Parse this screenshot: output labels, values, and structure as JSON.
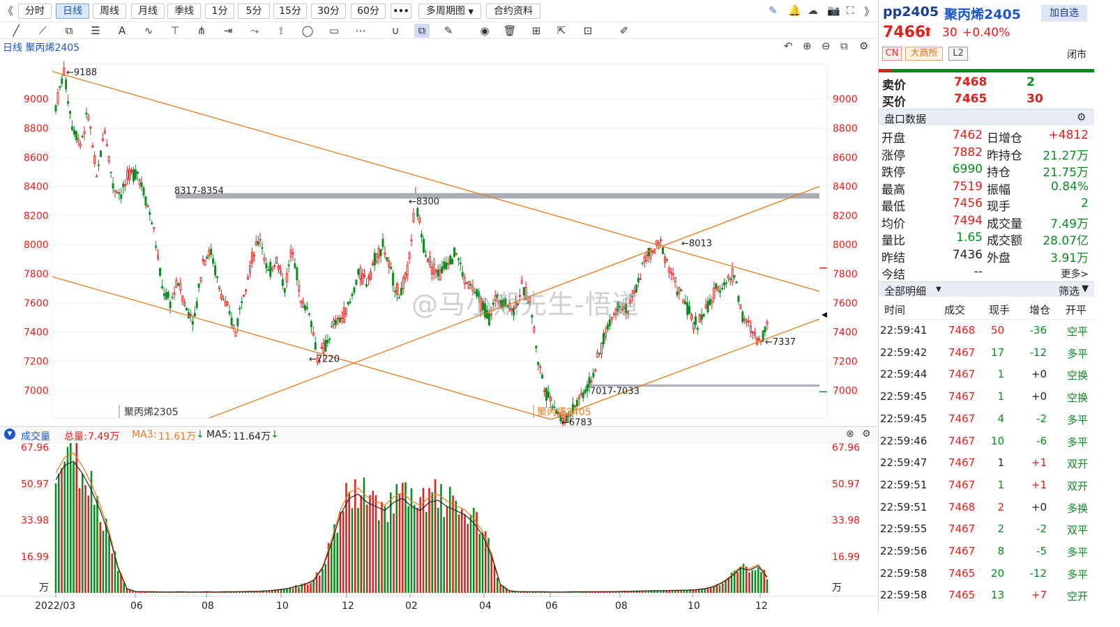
{
  "toolbar": {
    "back": "《",
    "periods": [
      {
        "label": "分时",
        "active": false
      },
      {
        "label": "日线",
        "active": true
      },
      {
        "label": "周线",
        "active": false
      },
      {
        "label": "月线",
        "active": false
      },
      {
        "label": "季线",
        "active": false
      },
      {
        "label": "1分",
        "active": false
      },
      {
        "label": "5分",
        "active": false
      },
      {
        "label": "15分",
        "active": false
      },
      {
        "label": "30分",
        "active": false
      },
      {
        "label": "60分",
        "active": false
      }
    ],
    "more": "•••",
    "multi": "多周期图",
    "contract": "合约资料",
    "right_icons": [
      "pen-icon",
      "bell-icon",
      "cloud-icon",
      "camera-icon",
      "fullscreen-icon",
      "collapse-icon"
    ],
    "right_glyphs": [
      "✎",
      "🔔",
      "☁",
      "📷",
      "⛶",
      "》"
    ]
  },
  "drawing_tools": {
    "glyphs": [
      "╱",
      "⟋",
      "⧉",
      "☰",
      "A",
      "∿",
      "⊤",
      "⋔",
      "⇥",
      "⤳",
      "⟟",
      "◯",
      "▭",
      "⋯",
      "∪",
      "⧉",
      "✎",
      "◉",
      "🗑",
      "⊞",
      "⇱",
      "⊡",
      "✐"
    ],
    "names": [
      "line-tool-icon",
      "ray-tool-icon",
      "crop-tool-icon",
      "fib-tool-icon",
      "text-tool-icon",
      "wave-tool-icon",
      "horizontal-line-icon",
      "fork-tool-icon",
      "range-tool-icon",
      "path-tool-icon",
      "flag-tool-icon",
      "ellipse-tool-icon",
      "rect-tool-icon",
      "more-tools-icon",
      "magnet-icon",
      "copy-draw-icon",
      "edit-draw-icon",
      "eye-icon",
      "trash-icon",
      "layers-icon",
      "export-icon",
      "comment-icon",
      "ruler-icon"
    ]
  },
  "chart_header": {
    "title": "日线 聚丙烯2405",
    "icons": [
      "↶",
      "⊕",
      "⊖",
      "⧉",
      "⚙"
    ]
  },
  "colors": {
    "up": "#e0201c",
    "down": "#0b8a22",
    "trend": "#e87a1e",
    "band": "#a8adb6",
    "axis_red": "#e0201c"
  },
  "chart_data": [
    {
      "type": "candlestick",
      "title": "日线 聚丙烯2405",
      "y_ticks": [
        7000,
        7200,
        7400,
        7600,
        7800,
        8000,
        8200,
        8400,
        8600,
        8800,
        9000
      ],
      "ylim": [
        6810,
        9240
      ],
      "x_ticks": [
        "2022/03",
        "06",
        "08",
        "10",
        "12",
        "02",
        "04",
        "06",
        "08",
        "10",
        "12"
      ],
      "key_points": [
        {
          "label": "9188",
          "x": "2022/03",
          "y": 9188
        },
        {
          "label": "8317-8354",
          "x": "2022/07",
          "y": 8354
        },
        {
          "label": "8300",
          "x": "2023/01",
          "y": 8300
        },
        {
          "label": "7220",
          "x": "2022/10",
          "y": 7220
        },
        {
          "label": "8013",
          "x": "2023/09",
          "y": 8013
        },
        {
          "label": "7337",
          "x": "2023/12",
          "y": 7337
        },
        {
          "label": "7017-7033",
          "x": "2023/07",
          "y": 7033
        },
        {
          "label": "6783",
          "x": "2023/06",
          "y": 6783
        }
      ],
      "close_series": [
        8950,
        9188,
        8820,
        8700,
        8900,
        8450,
        8800,
        8400,
        8350,
        8480,
        8500,
        8320,
        8100,
        7700,
        7600,
        7750,
        7550,
        7500,
        7900,
        7950,
        7700,
        7550,
        7400,
        7700,
        7900,
        8050,
        7800,
        7900,
        7700,
        8000,
        7600,
        7550,
        7220,
        7300,
        7450,
        7500,
        7600,
        7800,
        7750,
        7900,
        8000,
        7800,
        7650,
        7800,
        8300,
        8000,
        7850,
        7800,
        7900,
        7950,
        7750,
        7700,
        7600,
        7500,
        7650,
        7600,
        7550,
        7700,
        7620,
        7200,
        6980,
        6900,
        6783,
        6850,
        6950,
        7017,
        7150,
        7350,
        7500,
        7600,
        7550,
        7700,
        7900,
        7950,
        8013,
        7850,
        7700,
        7600,
        7450,
        7500,
        7600,
        7700,
        7750,
        7800,
        7500,
        7420,
        7337,
        7450
      ],
      "contract_labels": [
        "聚丙烯2305",
        "聚丙烯2405"
      ],
      "last_price_marker": 7466
    },
    {
      "type": "bar",
      "title": "成交量",
      "unit": "万",
      "y_ticks": [
        "67.96",
        "50.97",
        "33.98",
        "16.99"
      ],
      "ylim": [
        0,
        67.96
      ],
      "summary": {
        "total_label": "总量:",
        "total": "7.49万",
        "ma3_label": "MA3:",
        "ma3": "11.61万",
        "ma5_label": "MA5:",
        "ma5": "11.64万"
      },
      "volume_series": [
        55,
        62,
        64,
        58,
        50,
        40,
        28,
        12,
        2,
        0.6,
        0.5,
        0.5,
        0.4,
        0.4,
        0.5,
        0.4,
        0.4,
        0.5,
        0.4,
        0.5,
        0.5,
        0.6,
        0.7,
        0.8,
        1,
        1.5,
        2,
        3,
        4,
        6,
        12,
        24,
        38,
        46,
        48,
        44,
        42,
        40,
        44,
        46,
        42,
        40,
        44,
        45,
        42,
        40,
        38,
        34,
        28,
        18,
        4,
        1,
        0.6,
        0.5,
        0.5,
        0.5,
        0.4,
        0.4,
        0.5,
        0.5,
        0.5,
        0.5,
        0.6,
        0.6,
        0.7,
        0.8,
        0.9,
        1,
        1,
        1.1,
        1.2,
        1.3,
        1.5,
        2,
        3,
        5,
        8,
        12,
        11,
        13,
        7.49
      ]
    }
  ],
  "symbol": {
    "code": "pp2405",
    "name": "聚丙烯2405",
    "add_button": "加自选",
    "price": "7466",
    "arrow": "⬆",
    "change": "30",
    "change_pct": "+0.40%",
    "tags": [
      "CN",
      "大商所",
      "L2"
    ],
    "status": "闭市"
  },
  "order_book": [
    {
      "label": "卖价",
      "price": "7468",
      "qty": "2"
    },
    {
      "label": "买价",
      "price": "7465",
      "qty": "30"
    }
  ],
  "quote_header": "盘口数据",
  "quote_rows": [
    {
      "l1": "开盘",
      "v1": "7462",
      "c1": "red",
      "l2": "日增仓",
      "v2": "+4812",
      "c2": "red"
    },
    {
      "l1": "涨停",
      "v1": "7882",
      "c1": "red",
      "l2": "昨持仓",
      "v2": "21.27万",
      "c2": "green"
    },
    {
      "l1": "跌停",
      "v1": "6990",
      "c1": "green",
      "l2": "持仓",
      "v2": "21.75万",
      "c2": "green"
    },
    {
      "l1": "最高",
      "v1": "7519",
      "c1": "red",
      "l2": "振幅",
      "v2": "0.84%",
      "c2": "green"
    },
    {
      "l1": "最低",
      "v1": "7456",
      "c1": "red",
      "l2": "现手",
      "v2": "2",
      "c2": "green"
    },
    {
      "l1": "均价",
      "v1": "7494",
      "c1": "red",
      "l2": "成交量",
      "v2": "7.49万",
      "c2": "green"
    },
    {
      "l1": "量比",
      "v1": "1.65",
      "c1": "green",
      "l2": "成交额",
      "v2": "28.07亿",
      "c2": "green"
    },
    {
      "l1": "昨结",
      "v1": "7436",
      "c1": "blk",
      "l2": "外盘",
      "v2": "3.91万",
      "c2": "green"
    },
    {
      "l1": "今结",
      "v1": "--",
      "c1": "blk",
      "l2": "",
      "v2": "更多>",
      "c2": "blk"
    }
  ],
  "trades_header": {
    "title": "全部明细",
    "filter": "筛选",
    "cols": [
      "时间",
      "成交",
      "现手",
      "增仓",
      "开平"
    ]
  },
  "trades": [
    {
      "time": "22:59:41",
      "price": "7468",
      "qty": "50",
      "oi": "-36",
      "type": "空平",
      "pc": "red",
      "qc": "red",
      "oc": "green",
      "tc": "green"
    },
    {
      "time": "22:59:42",
      "price": "7467",
      "qty": "17",
      "oi": "-12",
      "type": "多平",
      "pc": "red",
      "qc": "green",
      "oc": "green",
      "tc": "green"
    },
    {
      "time": "22:59:44",
      "price": "7467",
      "qty": "1",
      "oi": "+0",
      "type": "空换",
      "pc": "red",
      "qc": "green",
      "oc": "blk",
      "tc": "green"
    },
    {
      "time": "22:59:45",
      "price": "7467",
      "qty": "1",
      "oi": "+0",
      "type": "空换",
      "pc": "red",
      "qc": "green",
      "oc": "blk",
      "tc": "green"
    },
    {
      "time": "22:59:45",
      "price": "7467",
      "qty": "4",
      "oi": "-2",
      "type": "多平",
      "pc": "red",
      "qc": "green",
      "oc": "green",
      "tc": "green"
    },
    {
      "time": "22:59:46",
      "price": "7467",
      "qty": "10",
      "oi": "-6",
      "type": "多平",
      "pc": "red",
      "qc": "green",
      "oc": "green",
      "tc": "green"
    },
    {
      "time": "22:59:47",
      "price": "7467",
      "qty": "1",
      "oi": "+1",
      "type": "双开",
      "pc": "red",
      "qc": "blk",
      "oc": "red",
      "tc": "green"
    },
    {
      "time": "22:59:51",
      "price": "7467",
      "qty": "1",
      "oi": "+1",
      "type": "双开",
      "pc": "red",
      "qc": "green",
      "oc": "red",
      "tc": "green"
    },
    {
      "time": "22:59:51",
      "price": "7468",
      "qty": "2",
      "oi": "+0",
      "type": "多换",
      "pc": "red",
      "qc": "red",
      "oc": "blk",
      "tc": "green"
    },
    {
      "time": "22:59:55",
      "price": "7467",
      "qty": "2",
      "oi": "-2",
      "type": "双平",
      "pc": "red",
      "qc": "green",
      "oc": "green",
      "tc": "green"
    },
    {
      "time": "22:59:56",
      "price": "7467",
      "qty": "8",
      "oi": "-5",
      "type": "多平",
      "pc": "red",
      "qc": "green",
      "oc": "green",
      "tc": "green"
    },
    {
      "time": "22:59:58",
      "price": "7465",
      "qty": "20",
      "oi": "-12",
      "type": "多平",
      "pc": "red",
      "qc": "green",
      "oc": "green",
      "tc": "green"
    },
    {
      "time": "22:59:58",
      "price": "7465",
      "qty": "13",
      "oi": "+7",
      "type": "空开",
      "pc": "red",
      "qc": "green",
      "oc": "red",
      "tc": "green"
    }
  ],
  "watermark": "@马小期先生-悟道"
}
